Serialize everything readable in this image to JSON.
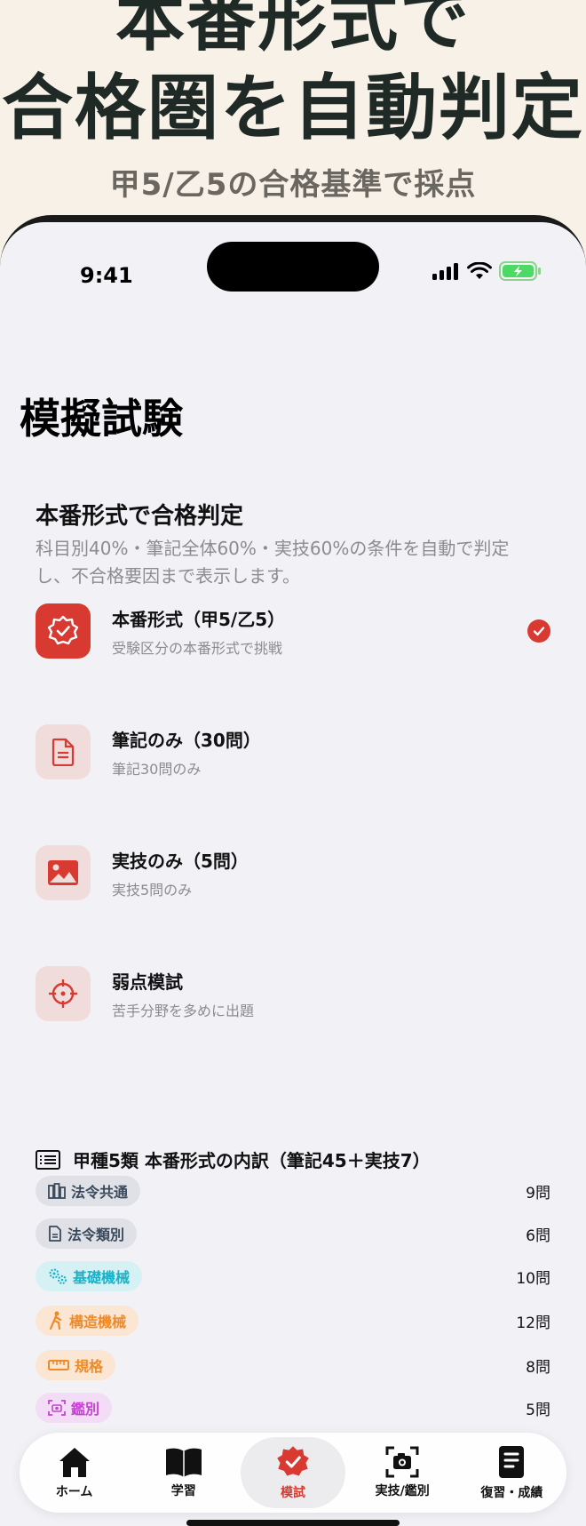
{
  "promo": {
    "line1": "本番形式で",
    "line2": "合格圏を自動判定",
    "sub": "甲5/乙5の合格基準で採点"
  },
  "status": {
    "time": "9:41"
  },
  "page": {
    "title": "模擬試験"
  },
  "intro": {
    "title": "本番形式で合格判定",
    "desc": "科目別40%・筆記全体60%・実技60%の条件を自動で判定し、不合格要因まで表示します。"
  },
  "options": [
    {
      "label": "本番形式（甲5/乙5）",
      "sub": "受験区分の本番形式で挑戦",
      "icon": "badge-check-icon",
      "selected": true
    },
    {
      "label": "筆記のみ（30問）",
      "sub": "筆記30問のみ",
      "icon": "document-icon",
      "selected": false
    },
    {
      "label": "実技のみ（5問）",
      "sub": "実技5問のみ",
      "icon": "image-icon",
      "selected": false
    },
    {
      "label": "弱点模試",
      "sub": "苦手分野を多めに出題",
      "icon": "target-icon",
      "selected": false
    }
  ],
  "breakdown": {
    "title": "甲種5類 本番形式の内訳（筆記45＋実技7）",
    "rows": [
      {
        "label": "法令共通",
        "count": "9問",
        "icon": "building-icon",
        "color": "#3a4a5c",
        "bg": "#dfe1e6"
      },
      {
        "label": "法令類別",
        "count": "6問",
        "icon": "document-icon",
        "color": "#3a4a5c",
        "bg": "#dfe1e6"
      },
      {
        "label": "基礎機械",
        "count": "10問",
        "icon": "gears-icon",
        "color": "#17b3c9",
        "bg": "#d6f1f4"
      },
      {
        "label": "構造機械",
        "count": "12問",
        "icon": "person-walking-icon",
        "color": "#f08a24",
        "bg": "#fbe6d4"
      },
      {
        "label": "規格",
        "count": "8問",
        "icon": "ruler-icon",
        "color": "#f08a24",
        "bg": "#fbe6d4"
      },
      {
        "label": "鑑別",
        "count": "5問",
        "icon": "camera-scan-icon",
        "color": "#c93fd6",
        "bg": "#f3dcf6"
      }
    ]
  },
  "tabs": [
    {
      "label": "ホーム",
      "icon": "house-icon",
      "active": false
    },
    {
      "label": "学習",
      "icon": "book-icon",
      "active": false
    },
    {
      "label": "模試",
      "icon": "badge-check-icon",
      "active": true
    },
    {
      "label": "実技/鑑別",
      "icon": "camera-scan-icon",
      "active": false
    },
    {
      "label": "復習・成績",
      "icon": "note-icon",
      "active": false
    }
  ],
  "colors": {
    "accent": "#d83a31",
    "background": "#f2f1f6",
    "promo_bg": "#f7f1e8"
  }
}
